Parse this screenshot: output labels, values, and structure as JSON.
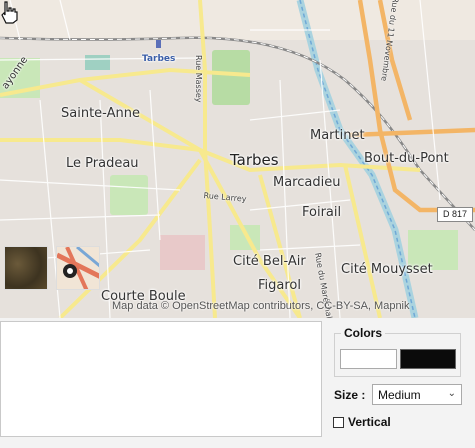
{
  "map": {
    "places": {
      "tarbes": "Tarbes",
      "sainte_anne": "Sainte-Anne",
      "le_pradeau": "Le Pradeau",
      "martinet": "Martinet",
      "bout_du_pont": "Bout-du-Pont",
      "marcadieu": "Marcadieu",
      "foirail": "Foirail",
      "cite_bel_air": "Cité Bel-Air",
      "figarol": "Figarol",
      "cite_mouysset": "Cité Mouysset",
      "courte_boule": "Courte Boule",
      "station": "Tarbes",
      "ayonne": "ayonne"
    },
    "roads": {
      "rue_massey": "Rue Massey",
      "rue_larrey": "Rue Larrey",
      "rue_11_novembre": "Rue du 11 Novembre",
      "rue_marechal": "Rue du Maréchal",
      "d817": "D 817"
    },
    "attribution": "Map data © OpenStreetMap contributors, CC-BY-SA, Mapnik",
    "layers": {
      "satellite_icon": "satellite-tile-icon",
      "osm_icon": "osm-tile-icon"
    }
  },
  "panel": {
    "colors_label": "Colors",
    "foreground_color": "#ffffff",
    "background_color": "#0b0b0b",
    "size_label": "Size :",
    "size_value": "Medium",
    "vertical_label": "Vertical",
    "vertical_checked": false
  }
}
